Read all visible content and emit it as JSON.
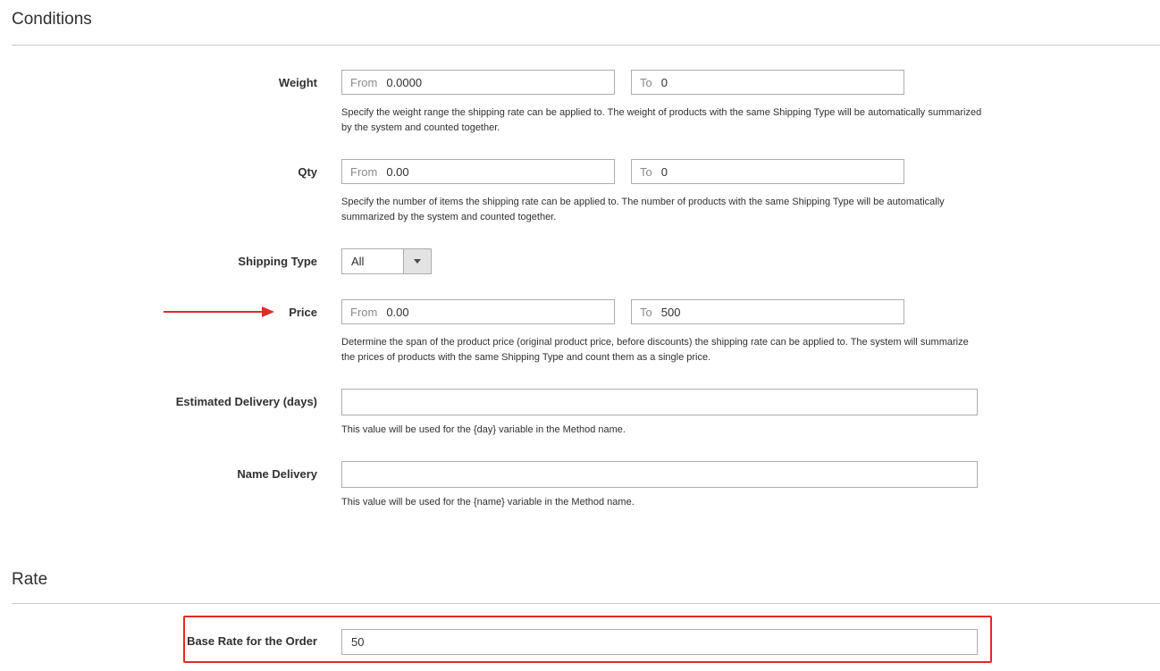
{
  "conditions": {
    "title": "Conditions",
    "weight": {
      "label": "Weight",
      "from_prefix": "From",
      "from_value": "0.0000",
      "to_prefix": "To",
      "to_value": "0",
      "note": "Specify the weight range the shipping rate can be applied to. The weight of products with the same Shipping Type will be automatically summarized by the system and counted together."
    },
    "qty": {
      "label": "Qty",
      "from_prefix": "From",
      "from_value": "0.00",
      "to_prefix": "To",
      "to_value": "0",
      "note": "Specify the number of items the shipping rate can be applied to. The number of products with the same Shipping Type will be automatically summarized by the system and counted together."
    },
    "shipping_type": {
      "label": "Shipping Type",
      "value": "All"
    },
    "price": {
      "label": "Price",
      "from_prefix": "From",
      "from_value": "0.00",
      "to_prefix": "To",
      "to_value": "500",
      "note": "Determine the span of the product price (original product price, before discounts) the shipping rate can be applied to. The system will summarize the prices of products with the same Shipping Type and count them as a single price."
    },
    "estimated_delivery": {
      "label": "Estimated Delivery (days)",
      "value": "",
      "note": "This value will be used for the {day} variable in the Method name."
    },
    "name_delivery": {
      "label": "Name Delivery",
      "value": "",
      "note": "This value will be used for the {name} variable in the Method name."
    }
  },
  "rate": {
    "title": "Rate",
    "base_rate": {
      "label": "Base Rate for the Order",
      "value": "50"
    }
  },
  "colors": {
    "annotation": "#e02b27",
    "border": "#adadad",
    "text": "#303030"
  }
}
